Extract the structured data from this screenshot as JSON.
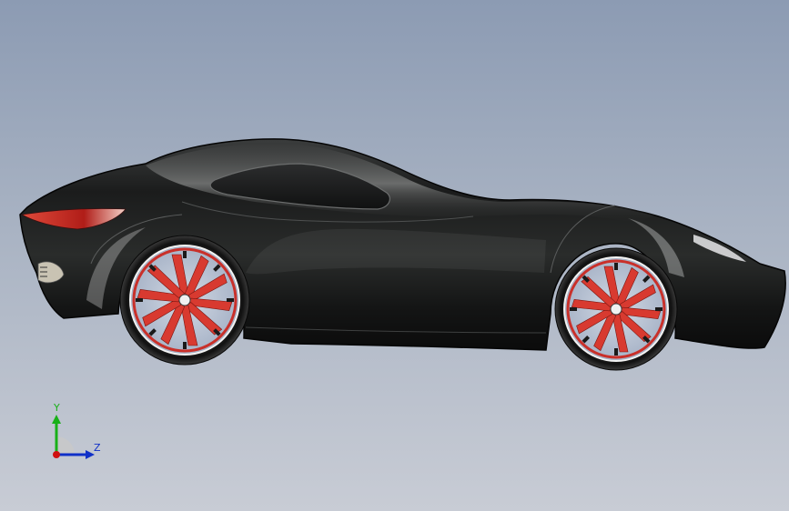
{
  "viewport": {
    "background_top": "#8c9bb3",
    "background_bottom": "#c8ccd5"
  },
  "model": {
    "body_color": "#1e1f1f",
    "rim_accent_color": "#d83a30",
    "wheel_count": 2
  },
  "triad": {
    "y_label": "Y",
    "z_label": "Z",
    "y_color": "#18b018",
    "z_color": "#1030c8",
    "x_color": "#d01010"
  }
}
